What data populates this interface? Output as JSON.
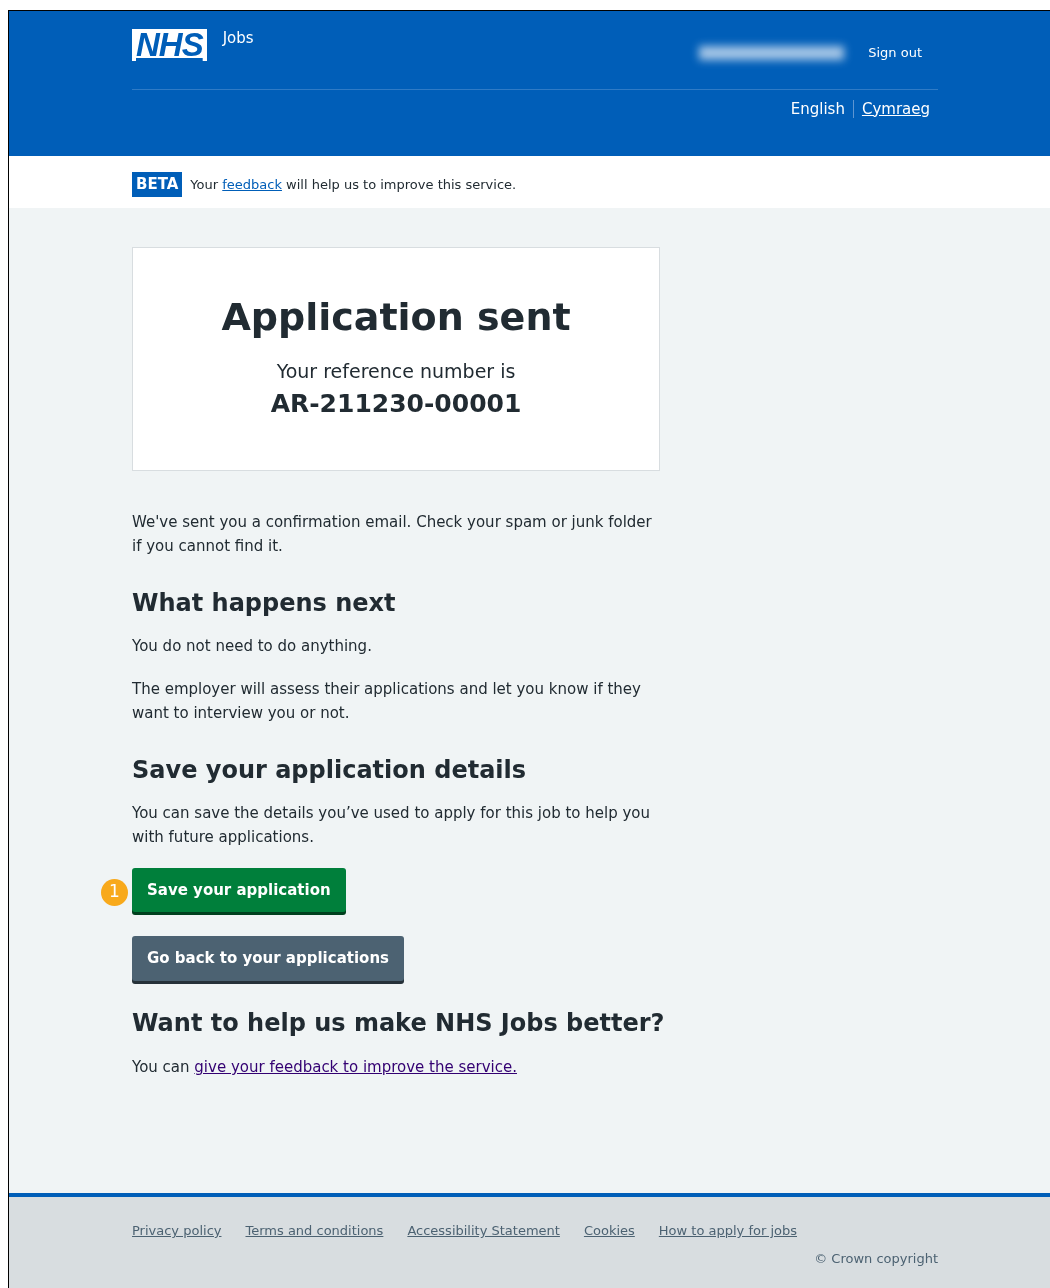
{
  "header": {
    "logo": "NHS",
    "service": "Jobs",
    "user_name_blurred": true,
    "sign_out": "Sign out",
    "languages": [
      {
        "label": "English",
        "selected": true
      },
      {
        "label": "Cymraeg",
        "selected": false
      }
    ]
  },
  "phase_banner": {
    "tag": "BETA",
    "before": "Your",
    "link": "feedback",
    "after": "will help us to improve this service."
  },
  "panel": {
    "title": "Application sent",
    "subtitle": "Your reference number is",
    "reference": "AR-211230-00001"
  },
  "intro": "We've sent you a confirmation email. Check your spam or junk folder if you cannot find it.",
  "sections": [
    {
      "heading": "What happens next",
      "paragraphs": [
        "You do not need to do anything.",
        "The employer will assess their applications and let you know if they want to interview you or not."
      ]
    },
    {
      "heading": "Save your application details",
      "paragraphs": [
        "You can save the details you’ve used to apply for this job to help you with future applications."
      ]
    }
  ],
  "buttons": [
    {
      "label": "Save your application",
      "kind": "primary",
      "callout": "1"
    },
    {
      "label": "Go back to your applications",
      "kind": "secondary"
    }
  ],
  "feedback": {
    "heading": "Want to help us make NHS Jobs better?",
    "before": "You can",
    "link": "give your feedback to improve the service."
  },
  "footer": {
    "links": [
      "Privacy policy",
      "Terms and conditions",
      "Accessibility Statement",
      "Cookies",
      "How to apply for jobs"
    ],
    "copyright": "© Crown copyright"
  }
}
